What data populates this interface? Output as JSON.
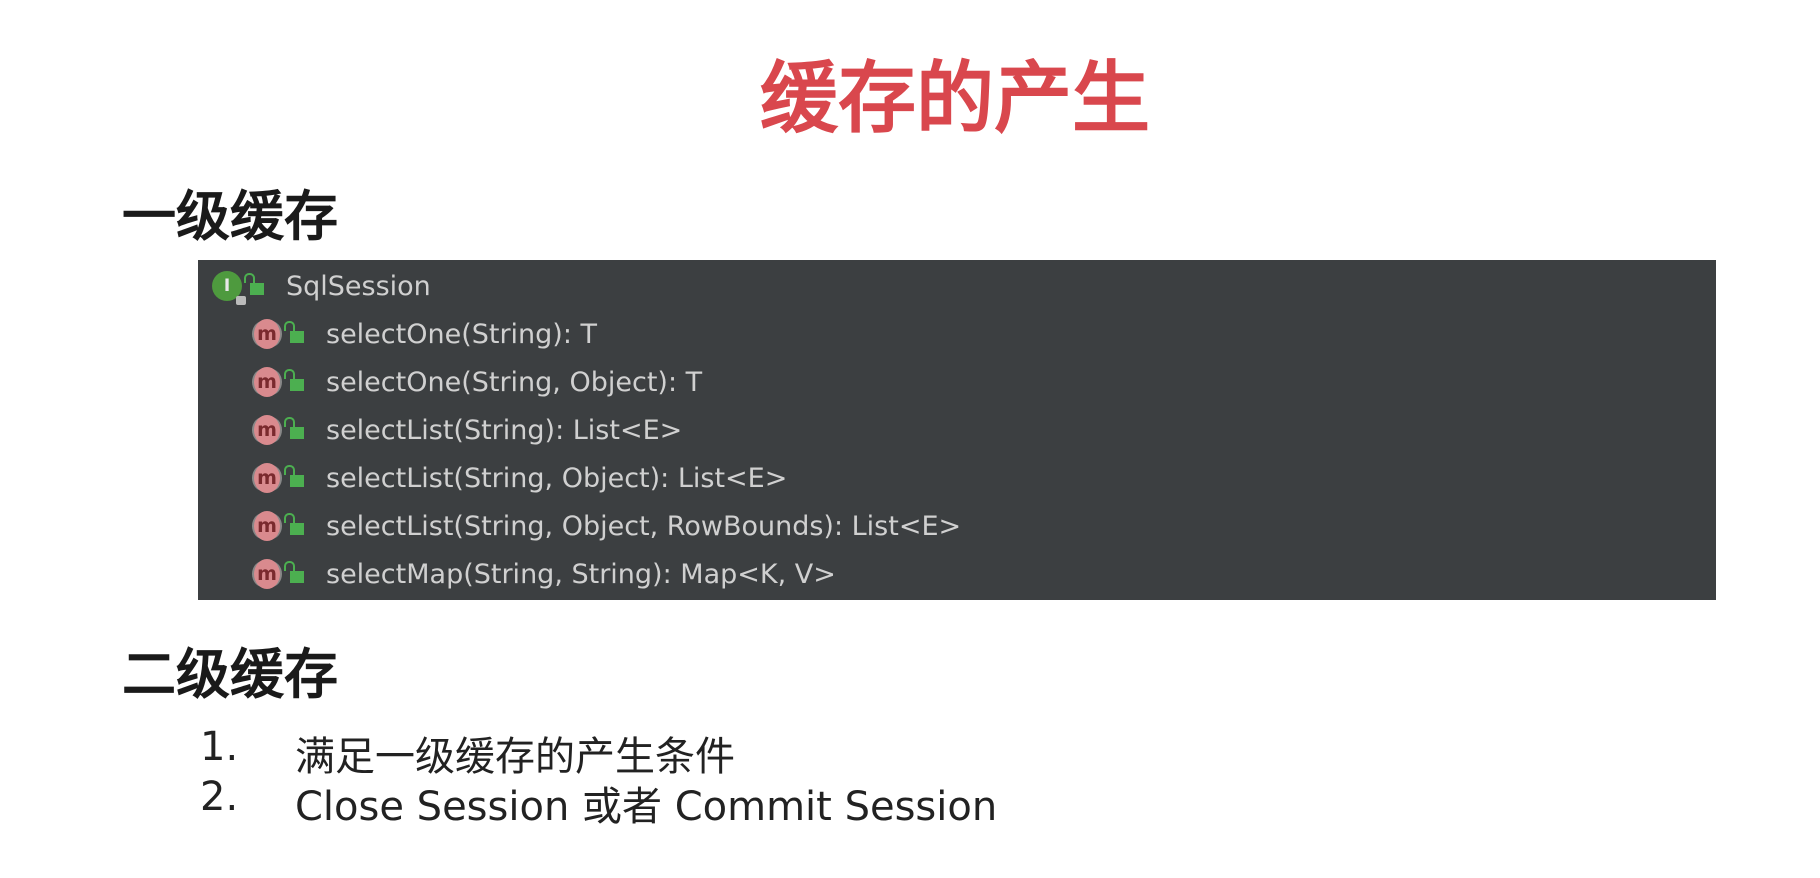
{
  "colors": {
    "accent": "#d9474d",
    "panel_bg": "#3c3f41"
  },
  "title": "缓存的产生",
  "section1": {
    "heading": "一级缓存",
    "tree": {
      "root": {
        "label": "SqlSession",
        "icon": "interface-icon"
      },
      "methods": [
        "selectOne(String): T",
        "selectOne(String, Object): T",
        "selectList(String): List<E>",
        "selectList(String, Object): List<E>",
        "selectList(String, Object, RowBounds): List<E>",
        "selectMap(String, String): Map<K, V>"
      ],
      "method_icon_glyph": "m",
      "interface_icon_glyph": "I"
    }
  },
  "section2": {
    "heading": "二级缓存",
    "items": [
      {
        "num": "1.",
        "text": "满足一级缓存的产生条件"
      },
      {
        "num": "2.",
        "text": "Close Session 或者 Commit Session"
      }
    ]
  }
}
